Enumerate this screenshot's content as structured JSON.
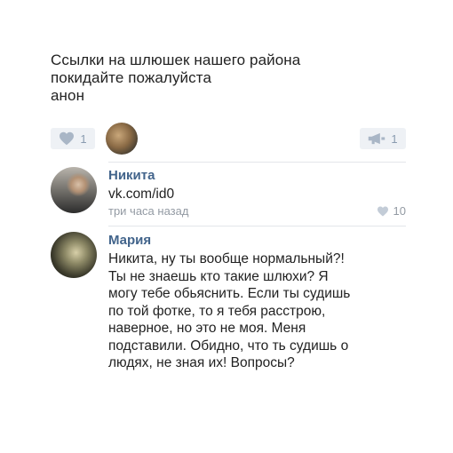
{
  "post": {
    "lines": [
      "Ссылки на шлюшек нашего района",
      "покидайте пожалуйста",
      "анон"
    ],
    "likes_count": "1",
    "reposts_count": "1"
  },
  "comments": [
    {
      "author": "Никита",
      "lines": [
        "vk.com/id0"
      ],
      "time": "три часа назад",
      "likes": "10"
    },
    {
      "author": "Мария",
      "lines": [
        "Никита, ну ты вообще нормальный?!",
        "Ты не знаешь кто такие шлюхи? Я",
        "могу тебе обьяснить. Если ты судишь",
        "по той фотке, то я тебя расстрою,",
        "наверное, но это не моя. Меня",
        "подставили. Обидно, что ть судишь о",
        "людях, не зная их! Вопросы?"
      ]
    }
  ],
  "colors": {
    "author_name": "#42648b",
    "meta_grey": "#939aa3",
    "pill_bg": "#eef1f5",
    "icon_grey": "#8a9bb0"
  },
  "icons": {
    "like": "heart-icon",
    "repost": "megaphone-icon"
  }
}
